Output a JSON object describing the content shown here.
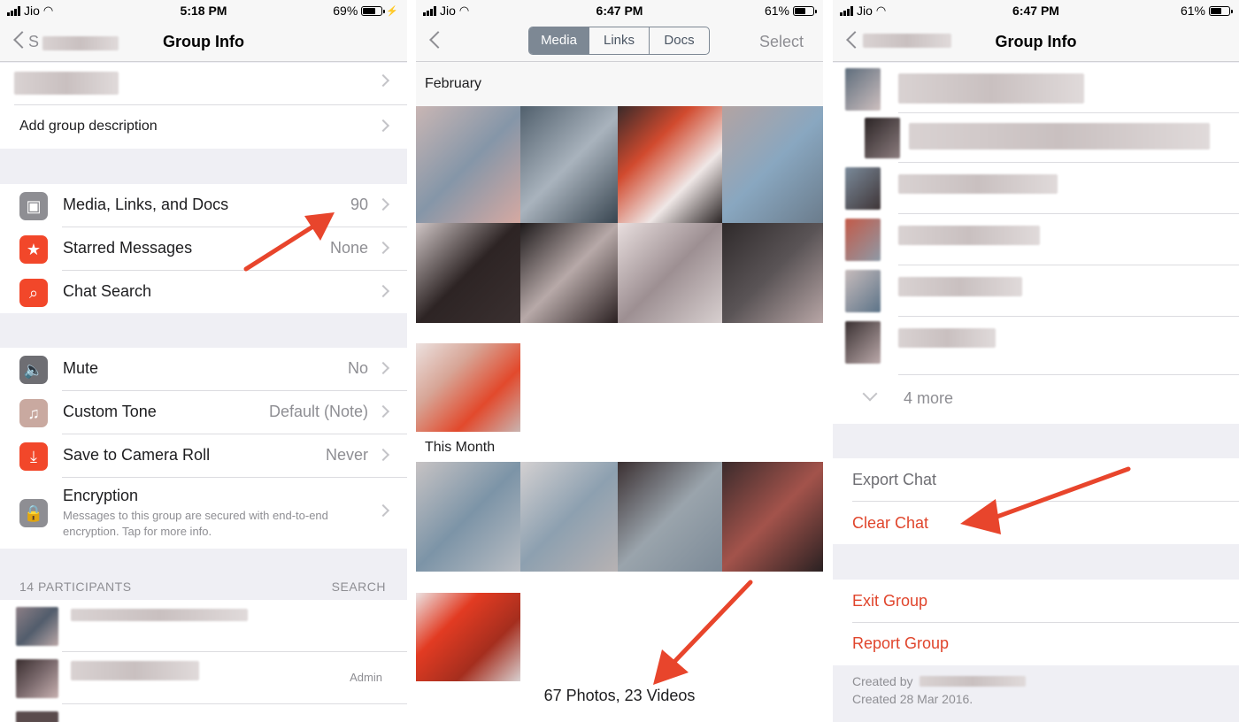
{
  "panel1": {
    "status": {
      "carrier": "Jio",
      "time": "5:18 PM",
      "battery": "69%",
      "battery_level": 0.69
    },
    "nav": {
      "back_label": "S",
      "title": "Group Info"
    },
    "add_description": "Add group description",
    "items": [
      {
        "label": "Media, Links, and Docs",
        "value": "90",
        "icon": "photo-icon",
        "color": "#8e8e93"
      },
      {
        "label": "Starred Messages",
        "value": "None",
        "icon": "star-icon",
        "color": "#f2472a"
      },
      {
        "label": "Chat Search",
        "value": "",
        "icon": "search-icon",
        "color": "#f2472a"
      }
    ],
    "settings": [
      {
        "label": "Mute",
        "value": "No",
        "icon": "speaker-icon",
        "color": "#6e6e73"
      },
      {
        "label": "Custom Tone",
        "value": "Default (Note)",
        "icon": "music-note-icon",
        "color": "#c9a9a0"
      },
      {
        "label": "Save to Camera Roll",
        "value": "Never",
        "icon": "download-icon",
        "color": "#f2472a"
      }
    ],
    "encryption": {
      "label": "Encryption",
      "description": "Messages to this group are secured with end-to-end encryption. Tap for more info."
    },
    "participants_header": "14 PARTICIPANTS",
    "participants_search": "SEARCH",
    "admin_label": "Admin"
  },
  "panel2": {
    "status": {
      "carrier": "Jio",
      "time": "6:47 PM",
      "battery": "61%",
      "battery_level": 0.61
    },
    "tabs": [
      "Media",
      "Links",
      "Docs"
    ],
    "select_label": "Select",
    "section_february": "February",
    "section_this_month": "This Month",
    "summary": "67 Photos, 23 Videos"
  },
  "panel3": {
    "status": {
      "carrier": "Jio",
      "time": "6:47 PM",
      "battery": "61%",
      "battery_level": 0.61
    },
    "nav": {
      "title": "Group Info"
    },
    "more_label": "4 more",
    "export_chat": "Export Chat",
    "clear_chat": "Clear Chat",
    "exit_group": "Exit Group",
    "report_group": "Report Group",
    "created_by": "Created by",
    "created_date": "Created 28 Mar 2016."
  },
  "colors": {
    "accent_red": "#e0452c",
    "arrow_red": "#e8452c",
    "gray": "#8e8e93"
  }
}
